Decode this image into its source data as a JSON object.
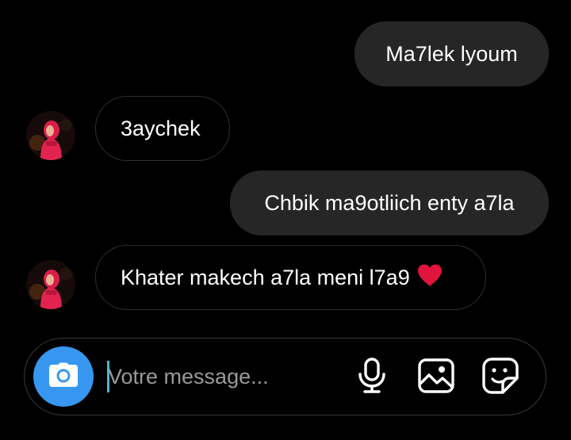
{
  "messages": [
    {
      "direction": "sent",
      "text": "Ma7lek lyoum"
    },
    {
      "direction": "received",
      "text": "3aychek"
    },
    {
      "direction": "sent",
      "text": "Chbik ma9otliich enty a7la"
    },
    {
      "direction": "received",
      "text": "Khater makech a7la meni l7a9",
      "emoji": "red-heart"
    }
  ],
  "composer": {
    "placeholder": "Votre message...",
    "value": ""
  },
  "icons": {
    "camera": "camera-icon",
    "mic": "microphone-icon",
    "gallery": "image-gallery-icon",
    "sticker": "sticker-icon"
  },
  "colors": {
    "background": "#000000",
    "sent_bubble": "#262626",
    "received_border": "#2e2e2e",
    "accent": "#3797f0",
    "heart": "#e0143c"
  }
}
